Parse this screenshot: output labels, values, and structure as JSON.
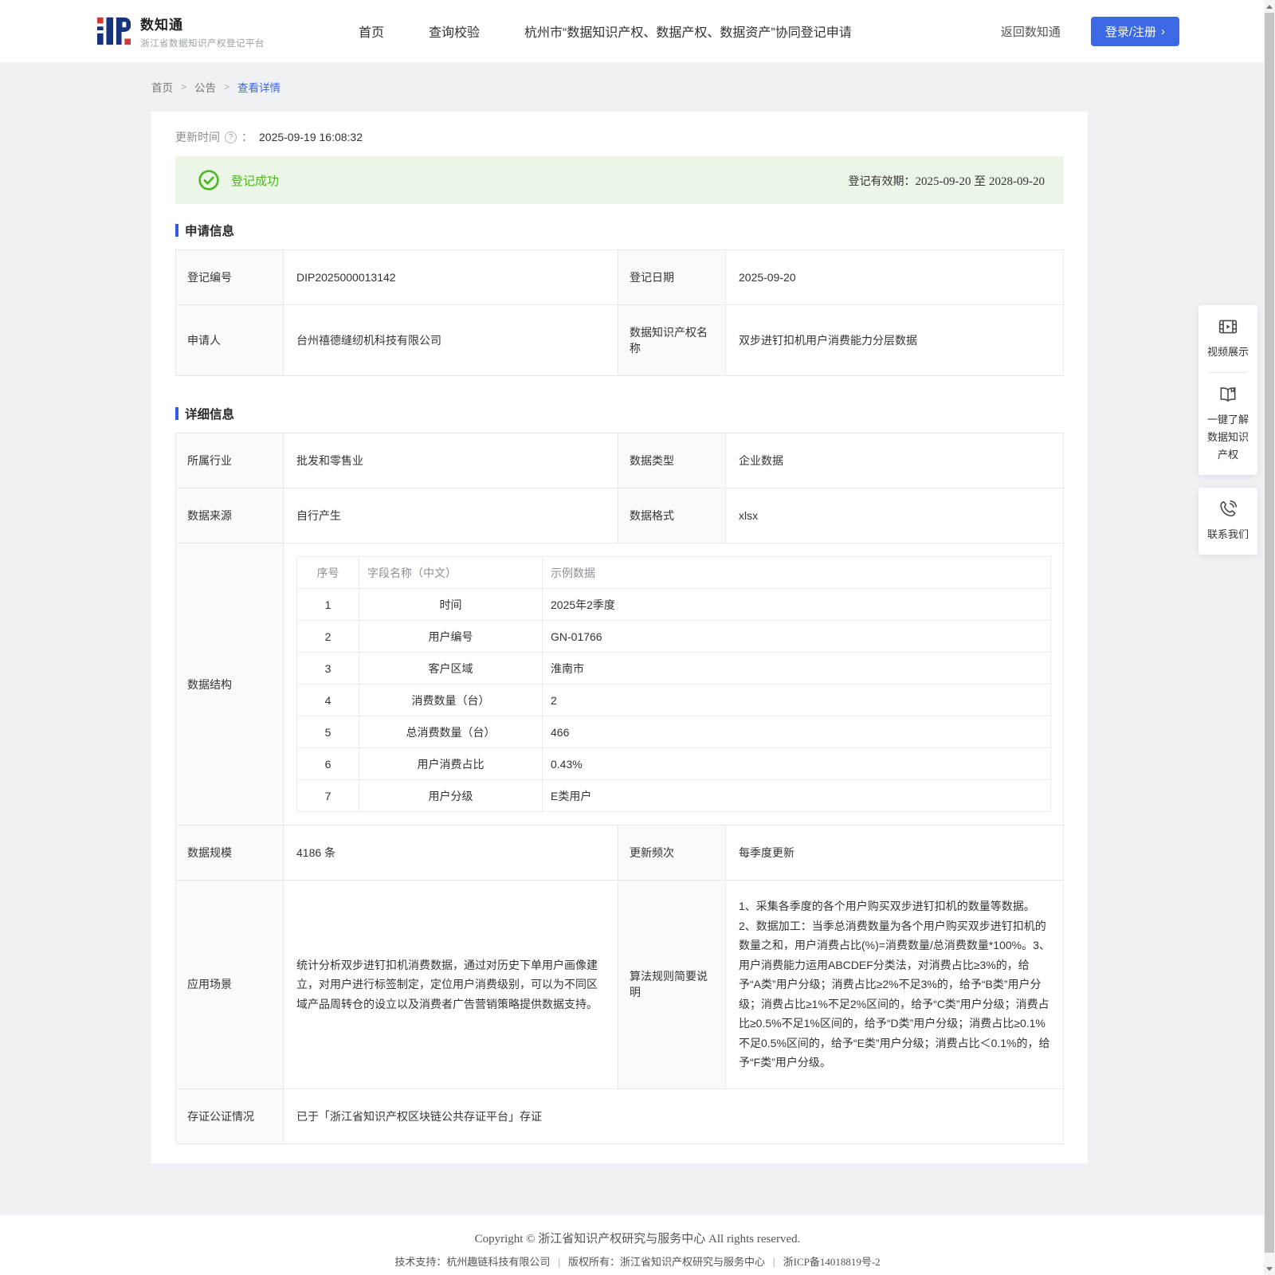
{
  "header": {
    "brand": {
      "title": "数知通",
      "subtitle": "浙江省数据知识产权登记平台"
    },
    "nav": [
      "首页",
      "查询校验",
      "杭州市“数据知识产权、数据产权、数据资产”协同登记申请"
    ],
    "back_link": "返回数知通",
    "login_label": "登录/注册",
    "login_chevron": "›",
    "accent_color": "#3d68e5"
  },
  "breadcrumb": {
    "items": [
      "首页",
      "公告",
      "查看详情"
    ],
    "separator": ">"
  },
  "meta": {
    "update_time_label": "更新时间",
    "question_mark": "?",
    "colon": "：",
    "update_time": "2025-09-19 16:08:32"
  },
  "banner": {
    "status": "登记成功",
    "validity_label": "登记有效期：",
    "validity": "2025-09-20 至 2028-09-20",
    "success_color": "#4cb81f"
  },
  "apply_info": {
    "title": "申请信息",
    "rows": [
      {
        "l1": "登记编号",
        "v1": "DIP2025000013142",
        "l2": "登记日期",
        "v2": "2025-09-20"
      },
      {
        "l1": "申请人",
        "v1": "台州禧德缝纫机科技有限公司",
        "l2": "数据知识产权名称",
        "v2": "双步进钉扣机用户消费能力分层数据"
      }
    ]
  },
  "detail_info": {
    "title": "详细信息",
    "row1": {
      "l1": "所属行业",
      "v1": "批发和零售业",
      "l2": "数据类型",
      "v2": "企业数据"
    },
    "row2": {
      "l1": "数据来源",
      "v1": "自行产生",
      "l2": "数据格式",
      "v2": "xlsx"
    },
    "structure": {
      "label": "数据结构",
      "columns": [
        "序号",
        "字段名称（中文）",
        "示例数据"
      ],
      "rows": [
        [
          "1",
          "时间",
          "2025年2季度"
        ],
        [
          "2",
          "用户编号",
          "GN-01766"
        ],
        [
          "3",
          "客户区域",
          "淮南市"
        ],
        [
          "4",
          "消费数量（台）",
          "2"
        ],
        [
          "5",
          "总消费数量（台）",
          "466"
        ],
        [
          "6",
          "用户消费占比",
          "0.43%"
        ],
        [
          "7",
          "用户分级",
          "E类用户"
        ]
      ]
    },
    "row4": {
      "l1": "数据规模",
      "v1": "4186 条",
      "l2": "更新频次",
      "v2": "每季度更新"
    },
    "row5": {
      "l1": "应用场景",
      "v1": "统计分析双步进钉扣机消费数据，通过对历史下单用户画像建立，对用户进行标签制定，定位用户消费级别，可以为不同区域产品周转仓的设立以及消费者广告营销策略提供数据支持。",
      "l2": "算法规则简要说明",
      "v2": "1、采集各季度的各个用户购买双步进钉扣机的数量等数据。2、数据加工：当季总消费数量为各个用户购买双步进钉扣机的数量之和，用户消费占比(%)=消费数量/总消费数量*100%。3、用户消费能力运用ABCDEF分类法，对消费占比≥3%的，给予“A类”用户分级；消费占比≥2%不足3%的，给予“B类”用户分级；消费占比≥1%不足2%区间的，给予“C类”用户分级；消费占比≥0.5%不足1%区间的，给予“D类”用户分级；消费占比≥0.1%不足0.5%区间的，给予“E类”用户分级；消费占比＜0.1%的，给予“F类”用户分级。"
    },
    "row6": {
      "l1": "存证公证情况",
      "v1": "已于「浙江省知识产权区块链公共存证平台」存证"
    }
  },
  "float_panel": {
    "video": "视频展示",
    "guide": "一键了解数据知识产权",
    "contact": "联系我们"
  },
  "footer": {
    "copyright": "Copyright © 浙江省知识产权研究与服务中心 All rights reserved.",
    "support": "技术支持：杭州趣链科技有限公司",
    "rights": "版权所有：浙江省知识产权研究与服务中心",
    "icp": "浙ICP备14018819号-2",
    "separator": "|"
  }
}
